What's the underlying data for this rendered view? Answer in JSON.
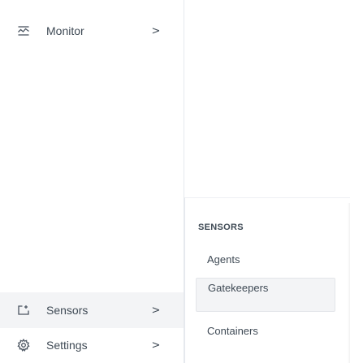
{
  "sidebar": {
    "items": [
      {
        "label": "Monitor",
        "icon": "monitor-icon",
        "chevron": ">"
      },
      {
        "label": "Sensors",
        "icon": "sensors-icon",
        "chevron": ">"
      },
      {
        "label": "Settings",
        "icon": "gear-icon",
        "chevron": ">"
      }
    ]
  },
  "flyout": {
    "title": "SENSORS",
    "items": [
      {
        "label": "Agents"
      },
      {
        "label": "Gatekeepers"
      },
      {
        "label": "Containers"
      }
    ]
  },
  "colors": {
    "text": "#3f4a55",
    "active_bg": "#f3f4f6",
    "divider": "#e6e9ee"
  }
}
